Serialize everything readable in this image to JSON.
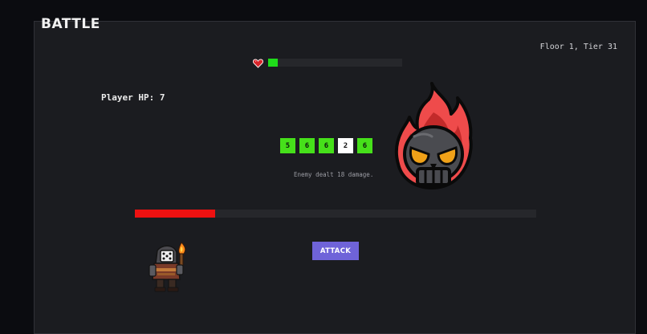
{
  "header": {
    "title": "BATTLE",
    "floor_info": "Floor 1, Tier 31"
  },
  "enemy": {
    "hp_fraction": 0.07,
    "hp_bar_color": "#1fdc1a",
    "icon": "flaming-skull-icon"
  },
  "player": {
    "hp_label": "Player HP: 7",
    "hp_fraction": 0.2,
    "hp_bar_color": "#ee1111",
    "icon": "dice-head-knight-icon"
  },
  "dice": [
    {
      "value": "5",
      "held": false
    },
    {
      "value": "6",
      "held": false
    },
    {
      "value": "6",
      "held": false
    },
    {
      "value": "2",
      "held": true
    },
    {
      "value": "6",
      "held": false
    }
  ],
  "log": {
    "message": "Enemy dealt 18 damage."
  },
  "actions": {
    "attack_label": "ATTACK"
  },
  "colors": {
    "background": "#0b0c10",
    "panel": "#1b1c20",
    "die_active": "#46e01a",
    "die_held": "#ffffff",
    "button": "#6f63d9"
  },
  "icons": {
    "heart": "heart-icon"
  }
}
